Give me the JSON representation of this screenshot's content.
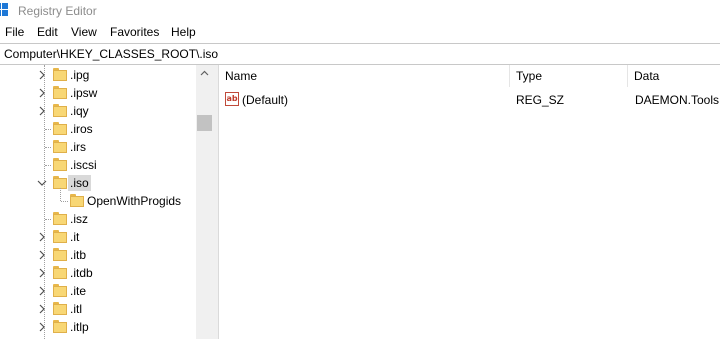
{
  "window": {
    "title": "Registry Editor"
  },
  "menu": [
    "File",
    "Edit",
    "View",
    "Favorites",
    "Help"
  ],
  "address": "Computer\\HKEY_CLASSES_ROOT\\.iso",
  "tree": [
    {
      "label": ".ipg",
      "expander": "collapsed"
    },
    {
      "label": ".ipsw",
      "expander": "collapsed"
    },
    {
      "label": ".iqy",
      "expander": "collapsed"
    },
    {
      "label": ".iros",
      "expander": "none"
    },
    {
      "label": ".irs",
      "expander": "none"
    },
    {
      "label": ".iscsi",
      "expander": "none"
    },
    {
      "label": ".iso",
      "expander": "expanded",
      "selected": true
    },
    {
      "label": "OpenWithProgids",
      "expander": "none",
      "child": true
    },
    {
      "label": ".isz",
      "expander": "none"
    },
    {
      "label": ".it",
      "expander": "collapsed"
    },
    {
      "label": ".itb",
      "expander": "collapsed"
    },
    {
      "label": ".itdb",
      "expander": "collapsed"
    },
    {
      "label": ".ite",
      "expander": "collapsed"
    },
    {
      "label": ".itl",
      "expander": "collapsed"
    },
    {
      "label": ".itlp",
      "expander": "collapsed"
    }
  ],
  "list": {
    "columns": [
      "Name",
      "Type",
      "Data"
    ],
    "rows": [
      {
        "name": "(Default)",
        "type": "REG_SZ",
        "data": "DAEMON.Tools.",
        "icon": "string-value-icon"
      }
    ]
  },
  "colors": {
    "folder": "#f8d775",
    "selection": "#d9d9d9",
    "icon_blue": "#1e78d7"
  }
}
